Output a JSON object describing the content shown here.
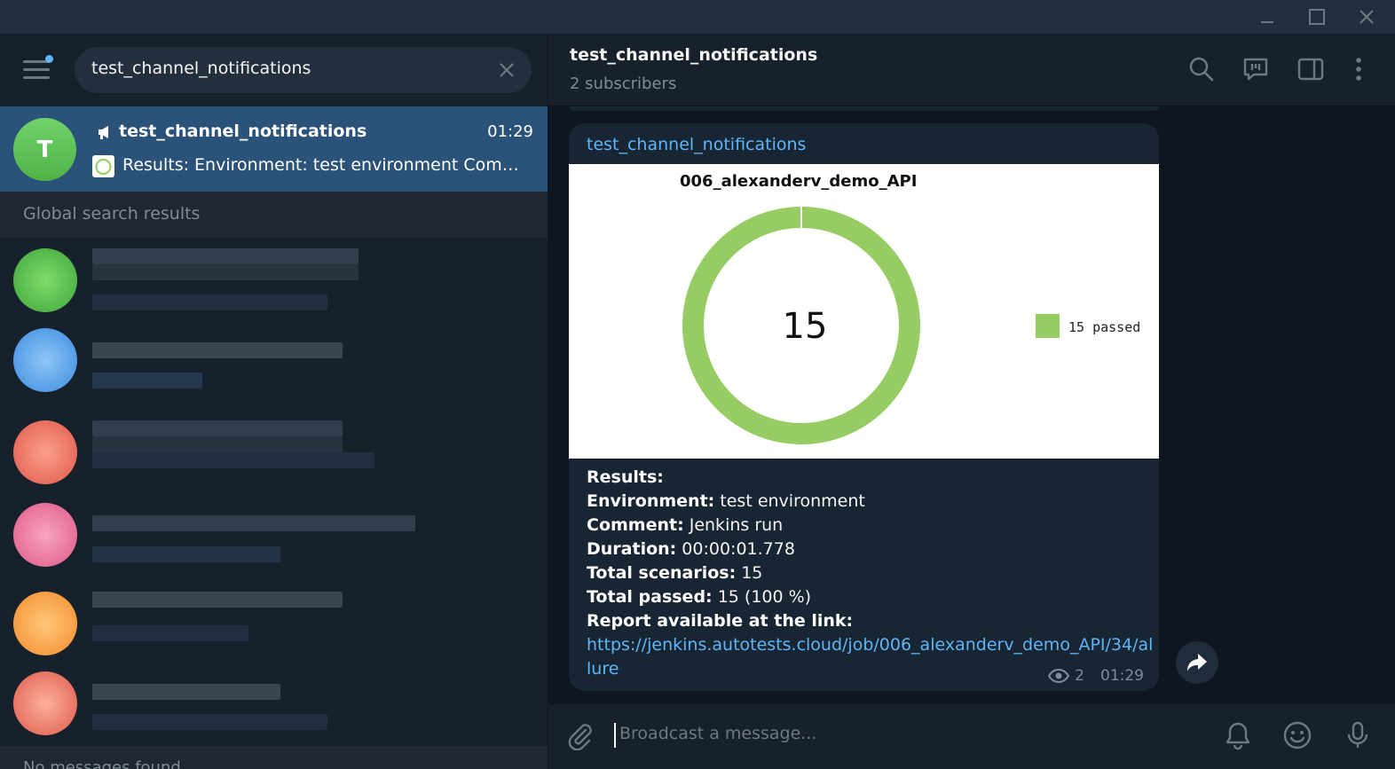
{
  "window": {
    "controls": [
      "minimize-icon",
      "maximize-icon",
      "close-icon"
    ]
  },
  "sidebar": {
    "search_value": "test_channel_notifications",
    "selected_chat": {
      "avatar_letter": "T",
      "name": "test_channel_notifications",
      "time": "01:29",
      "preview": "Results: Environment: test environment Comme..."
    },
    "global_search_label": "Global search results",
    "no_messages_label": "No messages found"
  },
  "chat": {
    "title": "test_channel_notifications",
    "subtitle": "2 subscribers",
    "message": {
      "sender": "test_channel_notifications",
      "chart_title": "006_alexanderv_demo_API",
      "chart_center": "15",
      "chart_legend": "15 passed",
      "results_label": "Results:",
      "environment_label": "Environment:",
      "environment_value": " test environment",
      "comment_label": "Comment:",
      "comment_value": " Jenkins run",
      "duration_label": "Duration:",
      "duration_value": " 00:00:01.778",
      "total_scenarios_label": "Total scenarios:",
      "total_scenarios_value": " 15",
      "total_passed_label": "Total passed:",
      "total_passed_value": " 15 (100 %)",
      "report_label": "Report available at the link:",
      "report_link": "https://jenkins.autotests.cloud/job/006_alexanderv_demo_API/34/allure",
      "views": "2",
      "time": "01:29"
    },
    "composer_placeholder": "Broadcast a message..."
  },
  "chart_data": {
    "type": "pie",
    "title": "006_alexanderv_demo_API",
    "categories": [
      "passed"
    ],
    "values": [
      15
    ],
    "center_label": "15",
    "legend": [
      "15 passed"
    ],
    "legend_position": "right",
    "colors": [
      "#97cc64"
    ]
  },
  "colors": {
    "accent": "#5eb5f7",
    "selected": "#2b5278",
    "passed": "#97cc64"
  }
}
